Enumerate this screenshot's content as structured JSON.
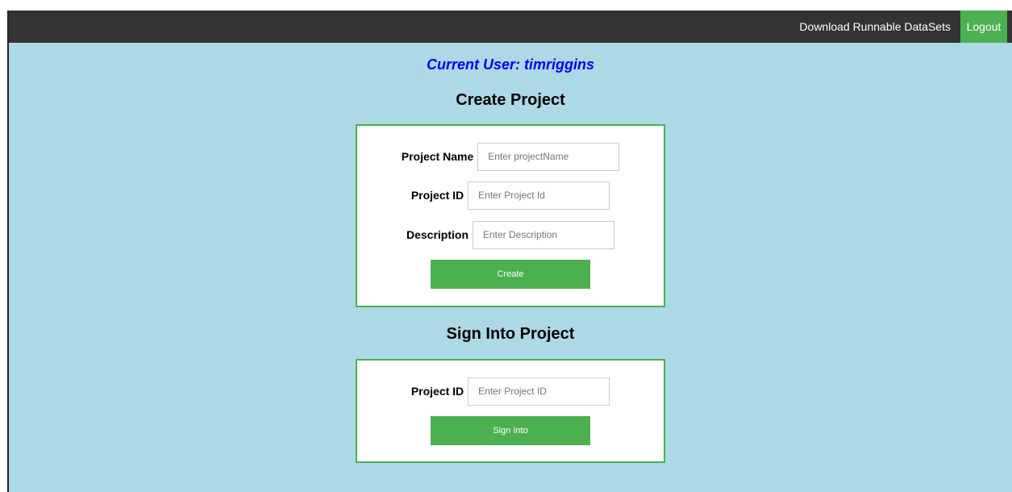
{
  "nav": {
    "download_label": "Download Runnable DataSets",
    "logout_label": "Logout"
  },
  "current_user": "Current User: timriggins",
  "create_project": {
    "heading": "Create Project",
    "fields": [
      {
        "label": "Project Name",
        "value": "",
        "placeholder": "Enter projectName"
      },
      {
        "label": "Project ID",
        "value": "",
        "placeholder": "Enter Project Id"
      },
      {
        "label": "Description",
        "value": "",
        "placeholder": "Enter Description"
      }
    ],
    "button_label": "Create"
  },
  "sign_in": {
    "heading": "Sign Into Project",
    "field": {
      "label": "Project ID",
      "value": "",
      "placeholder": "Enter Project ID"
    },
    "button_label": "Sign Into"
  },
  "colors": {
    "topbar": "#333333",
    "accent_green": "#4caf50",
    "page_background": "#add8e6",
    "current_user_text": "#0000ff"
  }
}
